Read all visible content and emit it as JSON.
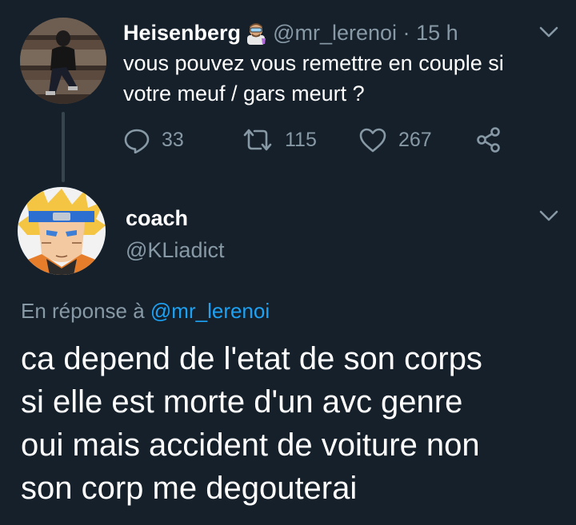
{
  "tweet": {
    "author": {
      "display_name": "Heisenberg",
      "handle": "@mr_lerenoi",
      "badge_emoji": "scientist-emoji"
    },
    "separator": "·",
    "time": "15 h",
    "text": "vous pouvez vous remettre en couple si votre meuf / gars meurt ?",
    "actions": {
      "replies": "33",
      "retweets": "115",
      "likes": "267"
    }
  },
  "reply": {
    "author": {
      "display_name": "coach",
      "handle": "@KLiadict"
    },
    "reply_to_prefix": "En réponse à",
    "reply_to_handle": "@mr_lerenoi",
    "text_lines": [
      "ca depend de l'etat de son corps",
      "si elle est morte d'un avc genre",
      "oui mais accident de voiture non",
      "son corp me degouterai"
    ]
  },
  "colors": {
    "background": "#15202b",
    "text_primary": "#ffffff",
    "text_secondary": "#8899a6",
    "link": "#1da1f2",
    "thread_line": "#38444d"
  },
  "icons": [
    "reply-icon",
    "retweet-icon",
    "like-icon",
    "share-icon",
    "chevron-down-icon"
  ]
}
